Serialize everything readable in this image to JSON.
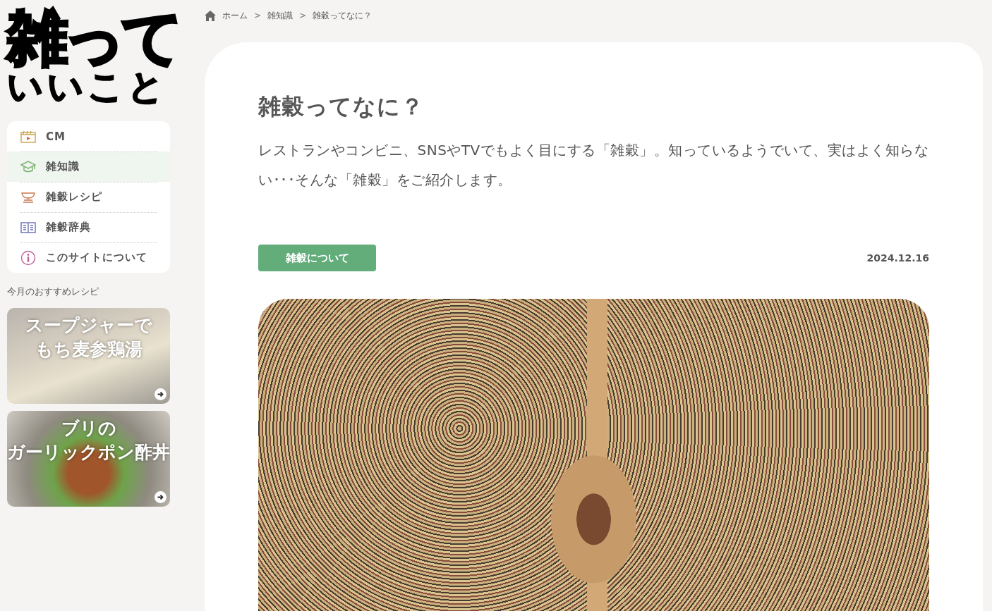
{
  "logo": {
    "line_1": "雑って",
    "line_2": "いいこと"
  },
  "nav": {
    "items": [
      {
        "kind": "video",
        "label": "CM",
        "selected": false
      },
      {
        "kind": "learn",
        "label": "雑知識",
        "selected": true
      },
      {
        "kind": "bowl",
        "label": "雑穀レシピ",
        "selected": false
      },
      {
        "kind": "book",
        "label": "雑穀辞典",
        "selected": false
      },
      {
        "kind": "info",
        "label": "このサイトについて",
        "selected": false
      }
    ]
  },
  "recommend": {
    "heading": "今月のおすすめレシピ",
    "cards": [
      {
        "lines": [
          "スープジャーで",
          "もち麦参鶏湯"
        ]
      },
      {
        "lines": [
          "ブリの",
          "ガーリックポン酢丼"
        ]
      }
    ]
  },
  "breadcrumb": [
    "ホーム",
    "雑知識",
    "雑穀ってなに？"
  ],
  "breadcrumb_separator": ">",
  "article": {
    "title": "雑穀ってなに？",
    "lead": "レストランやコンビニ、SNSやTVでもよく目にする「雑穀」。知っているようでいて、実はよく知らない･･･そんな「雑穀」をご紹介します。",
    "category": "雑穀について",
    "date": "2024.12.16"
  }
}
